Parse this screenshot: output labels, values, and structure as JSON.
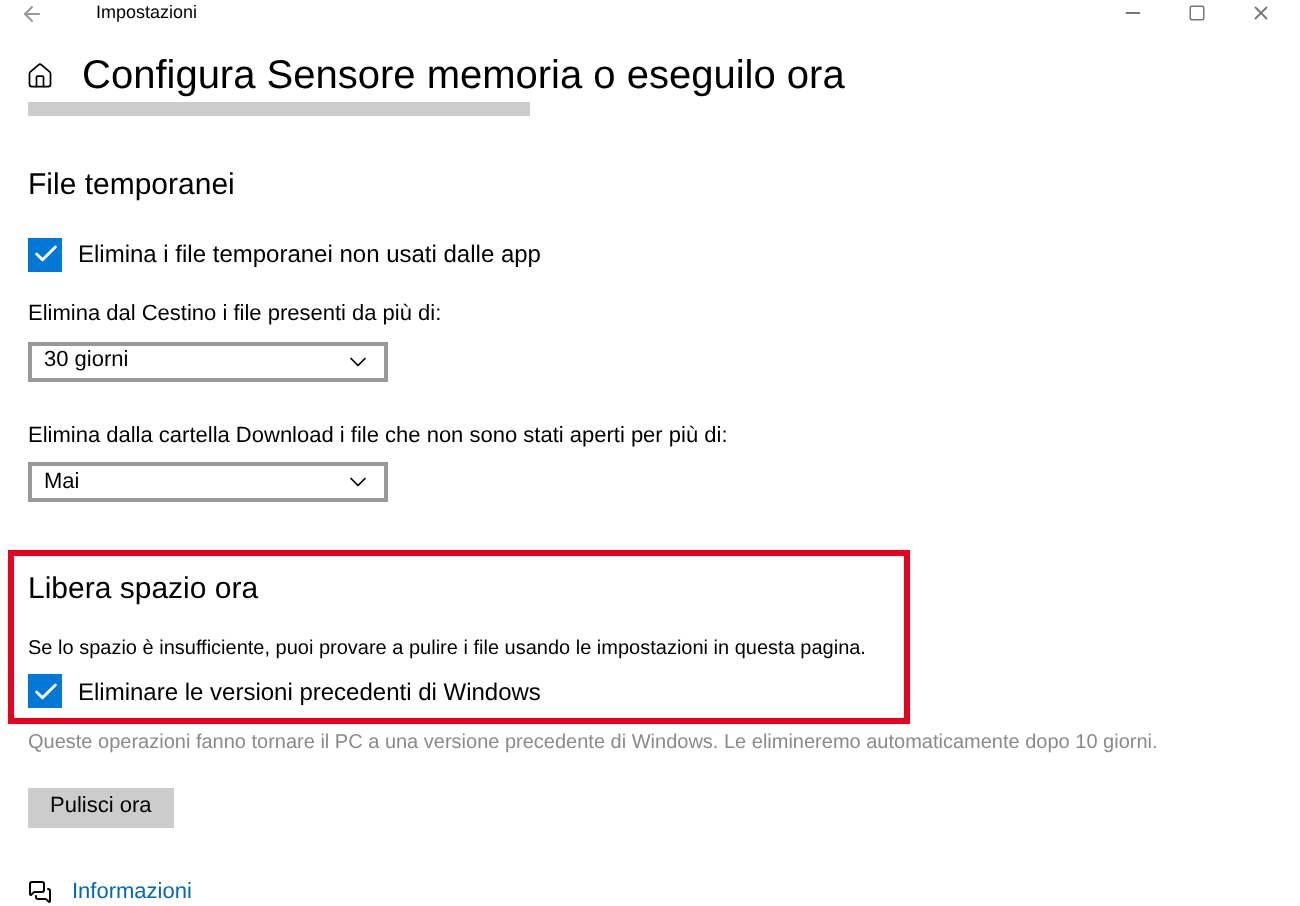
{
  "window": {
    "title": "Impostazioni"
  },
  "page_title": "Configura Sensore memoria o eseguilo ora",
  "temp_files": {
    "heading": "File temporanei",
    "delete_unused": {
      "label": "Elimina i file temporanei non usati dalle app",
      "checked": true
    },
    "recycle_bin": {
      "label": "Elimina dal Cestino i file presenti da più di:",
      "value": "30 giorni"
    },
    "downloads": {
      "label": "Elimina dalla cartella Download i file che non sono stati aperti per più di:",
      "value": "Mai"
    }
  },
  "free_space": {
    "heading": "Libera spazio ora",
    "highlighted": true,
    "description": "Se lo spazio è insufficiente, puoi provare a pulire i file usando le impostazioni in questa pagina.",
    "previous_windows": {
      "label": "Eliminare le versioni precedenti di Windows",
      "checked": true
    },
    "note": "Queste operazioni fanno tornare il PC a una versione precedente di Windows. Le elimineremo automaticamente dopo 10 giorni.",
    "button": "Pulisci ora"
  },
  "info_link": "Informazioni"
}
